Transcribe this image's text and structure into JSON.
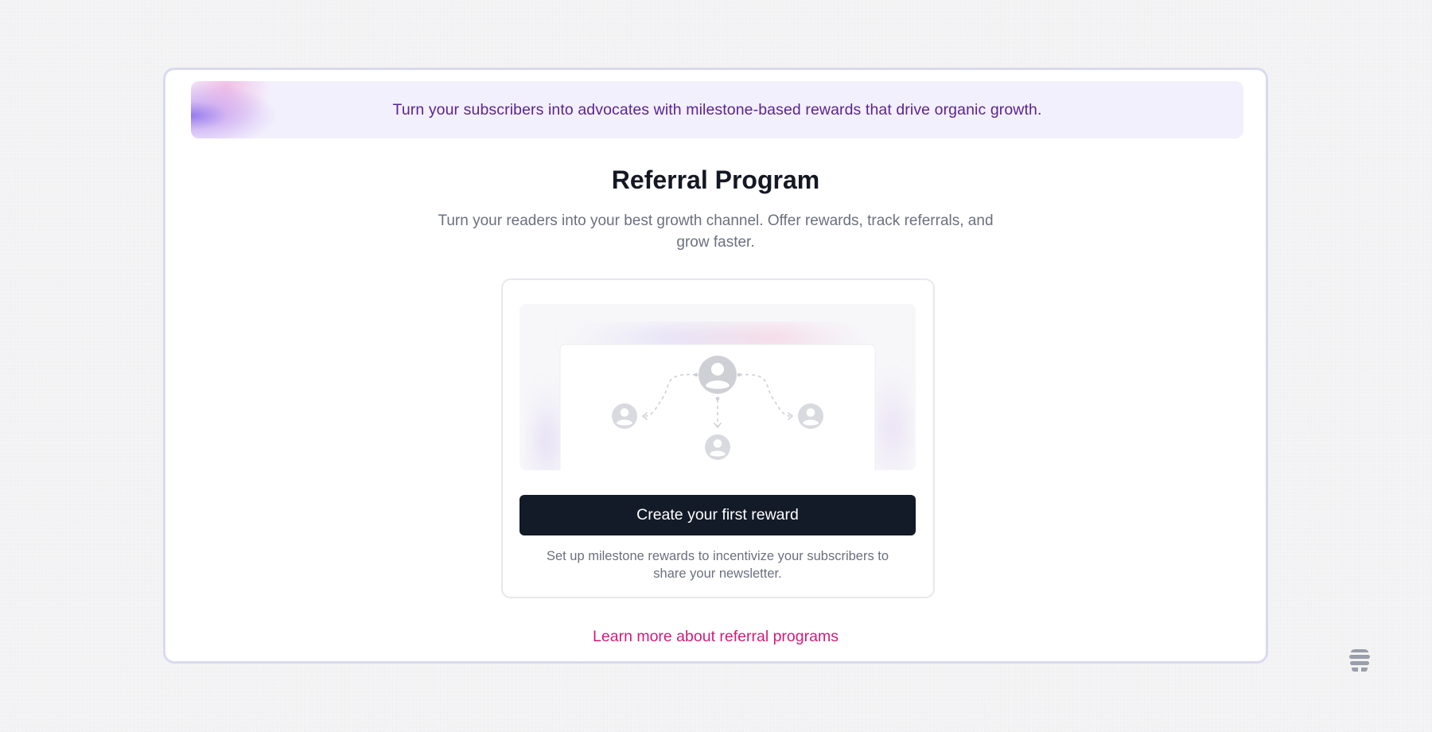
{
  "banner": {
    "text": "Turn your subscribers into advocates with milestone-based rewards that drive organic growth."
  },
  "page": {
    "title": "Referral Program",
    "subtitle": "Turn your readers into your best growth channel. Offer rewards, track referrals, and grow faster."
  },
  "empty_state": {
    "illustration_icon": "referral-network-icon",
    "cta_label": "Create your first reward",
    "cta_description": "Set up milestone rewards to incentivize your subscribers to share your newsletter."
  },
  "footer": {
    "learn_more_label": "Learn more about referral programs"
  },
  "corner_logo": {
    "icon": "beehive-logo-icon"
  },
  "colors": {
    "banner_text": "#5b2490",
    "banner_bg": "#f3f0fd",
    "cta_bg": "#131a28",
    "link": "#d21b7a",
    "card_border": "#d9daf0"
  }
}
